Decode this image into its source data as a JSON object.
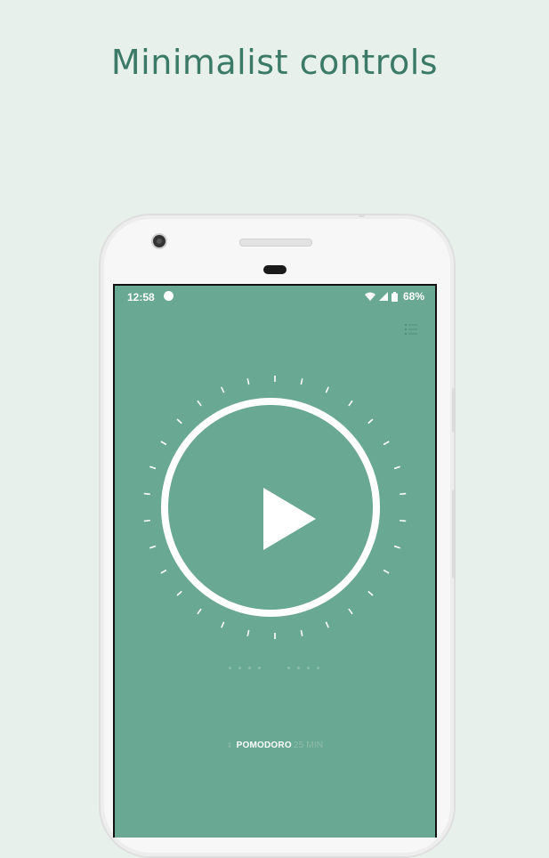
{
  "headline": "Minimalist controls",
  "status_bar": {
    "time": "12:58",
    "battery": "68%",
    "icons": [
      "notification-dot-icon",
      "wifi-icon",
      "signal-icon",
      "battery-icon"
    ]
  },
  "toolbar": {
    "menu_icon": "list-menu-icon"
  },
  "timer": {
    "play_icon": "play-icon",
    "mode": "POMODORO",
    "duration": "25 MIN",
    "sessions_total": 8,
    "sessions_completed": 0
  },
  "colors": {
    "background": "#e8f0ec",
    "headline": "#3a7a66",
    "screen": "#69a892",
    "foreground": "#ffffff"
  }
}
